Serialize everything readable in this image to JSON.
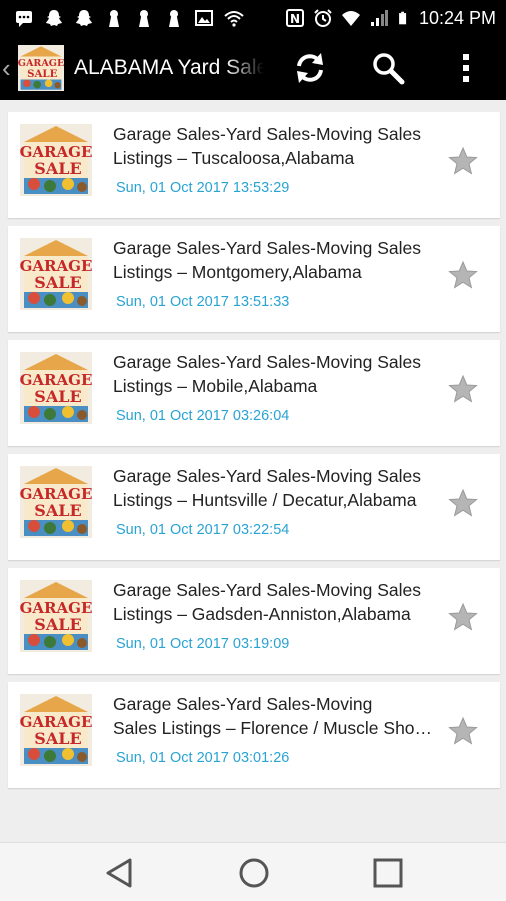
{
  "status_bar": {
    "time": "10:24 PM",
    "icons": [
      "chat-icon",
      "snapchat-icon",
      "snapchat-icon",
      "keyhole-icon",
      "keyhole-icon",
      "keyhole-icon",
      "image-icon",
      "wifi-signal-icon",
      "nfc-icon",
      "alarm-icon",
      "wifi-icon",
      "cell-signal-icon",
      "battery-icon"
    ]
  },
  "action_bar": {
    "title": "ALABAMA Yard Sales",
    "logo_text": [
      "GARAGE",
      "SALE"
    ],
    "actions": [
      "refresh-icon",
      "search-icon",
      "overflow-menu-icon"
    ]
  },
  "listings": [
    {
      "title_line1": "Garage Sales-Yard Sales-Moving Sales",
      "title_line2": "Listings – Tuscaloosa,Alabama",
      "date": "Sun, 01 Oct 2017 13:53:29"
    },
    {
      "title_line1": "Garage Sales-Yard Sales-Moving Sales",
      "title_line2": "Listings – Montgomery,Alabama",
      "date": "Sun, 01 Oct 2017 13:51:33"
    },
    {
      "title_line1": "Garage Sales-Yard Sales-Moving Sales",
      "title_line2": "Listings – Mobile,Alabama",
      "date": "Sun, 01 Oct 2017 03:26:04"
    },
    {
      "title_line1": "Garage Sales-Yard Sales-Moving Sales",
      "title_line2": "Listings – Huntsville / Decatur,Alabama",
      "date": "Sun, 01 Oct 2017 03:22:54"
    },
    {
      "title_line1": "Garage Sales-Yard Sales-Moving Sales",
      "title_line2": "Listings – Gadsden-Anniston,Alabama",
      "date": "Sun, 01 Oct 2017 03:19:09"
    },
    {
      "title_line1": "Garage Sales-Yard Sales-Moving",
      "title_line2": "Sales Listings – Florence / Muscle Sho…",
      "date": "Sun, 01 Oct 2017 03:01:26"
    }
  ],
  "thumb_text": [
    "GARAGE",
    "SALE"
  ],
  "nav_bar": {
    "buttons": [
      "back-icon",
      "home-icon",
      "recents-icon"
    ]
  },
  "colors": {
    "date": "#29a3d3",
    "action_bar": "#000000",
    "list_background": "#eeeeee"
  }
}
